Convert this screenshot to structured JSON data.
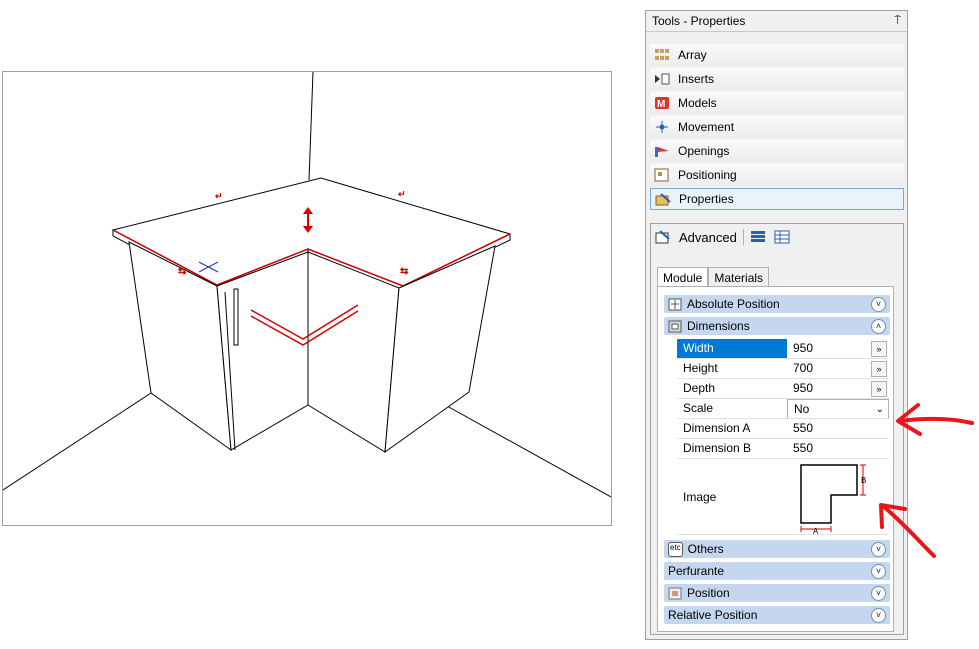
{
  "panel": {
    "title": "Tools - Properties",
    "pin_glyph": "⍑"
  },
  "tools": [
    {
      "label": "Array",
      "icon": "array-icon"
    },
    {
      "label": "Inserts",
      "icon": "inserts-icon"
    },
    {
      "label": "Models",
      "icon": "models-icon"
    },
    {
      "label": "Movement",
      "icon": "movement-icon"
    },
    {
      "label": "Openings",
      "icon": "openings-icon"
    },
    {
      "label": "Positioning",
      "icon": "positioning-icon"
    },
    {
      "label": "Properties",
      "icon": "properties-icon",
      "selected": true
    }
  ],
  "properties": {
    "advanced_label": "Advanced",
    "tabs": [
      "Module",
      "Materials"
    ],
    "active_tab": "Module",
    "sections": {
      "absolute_position": "Absolute Position",
      "dimensions": "Dimensions",
      "others": "Others",
      "perfurante": "Perfurante",
      "position": "Position",
      "relative_position": "Relative Position"
    },
    "dimensions": {
      "width_label": "Width",
      "width_value": "950",
      "height_label": "Height",
      "height_value": "700",
      "depth_label": "Depth",
      "depth_value": "950",
      "scale_label": "Scale",
      "scale_value": "No",
      "dim_a_label": "Dimension A",
      "dim_a_value": "550",
      "dim_b_label": "Dimension B",
      "dim_b_value": "550",
      "image_label": "Image",
      "image_a": "A",
      "image_b": "B"
    },
    "others_icon_text": "etc",
    "more_glyph": "»",
    "chevron_down": "˅",
    "chevron_up": "˄"
  },
  "colors": {
    "accent": "#0078d7",
    "section": "#c5d7ee",
    "annotation": "#e8161b"
  }
}
